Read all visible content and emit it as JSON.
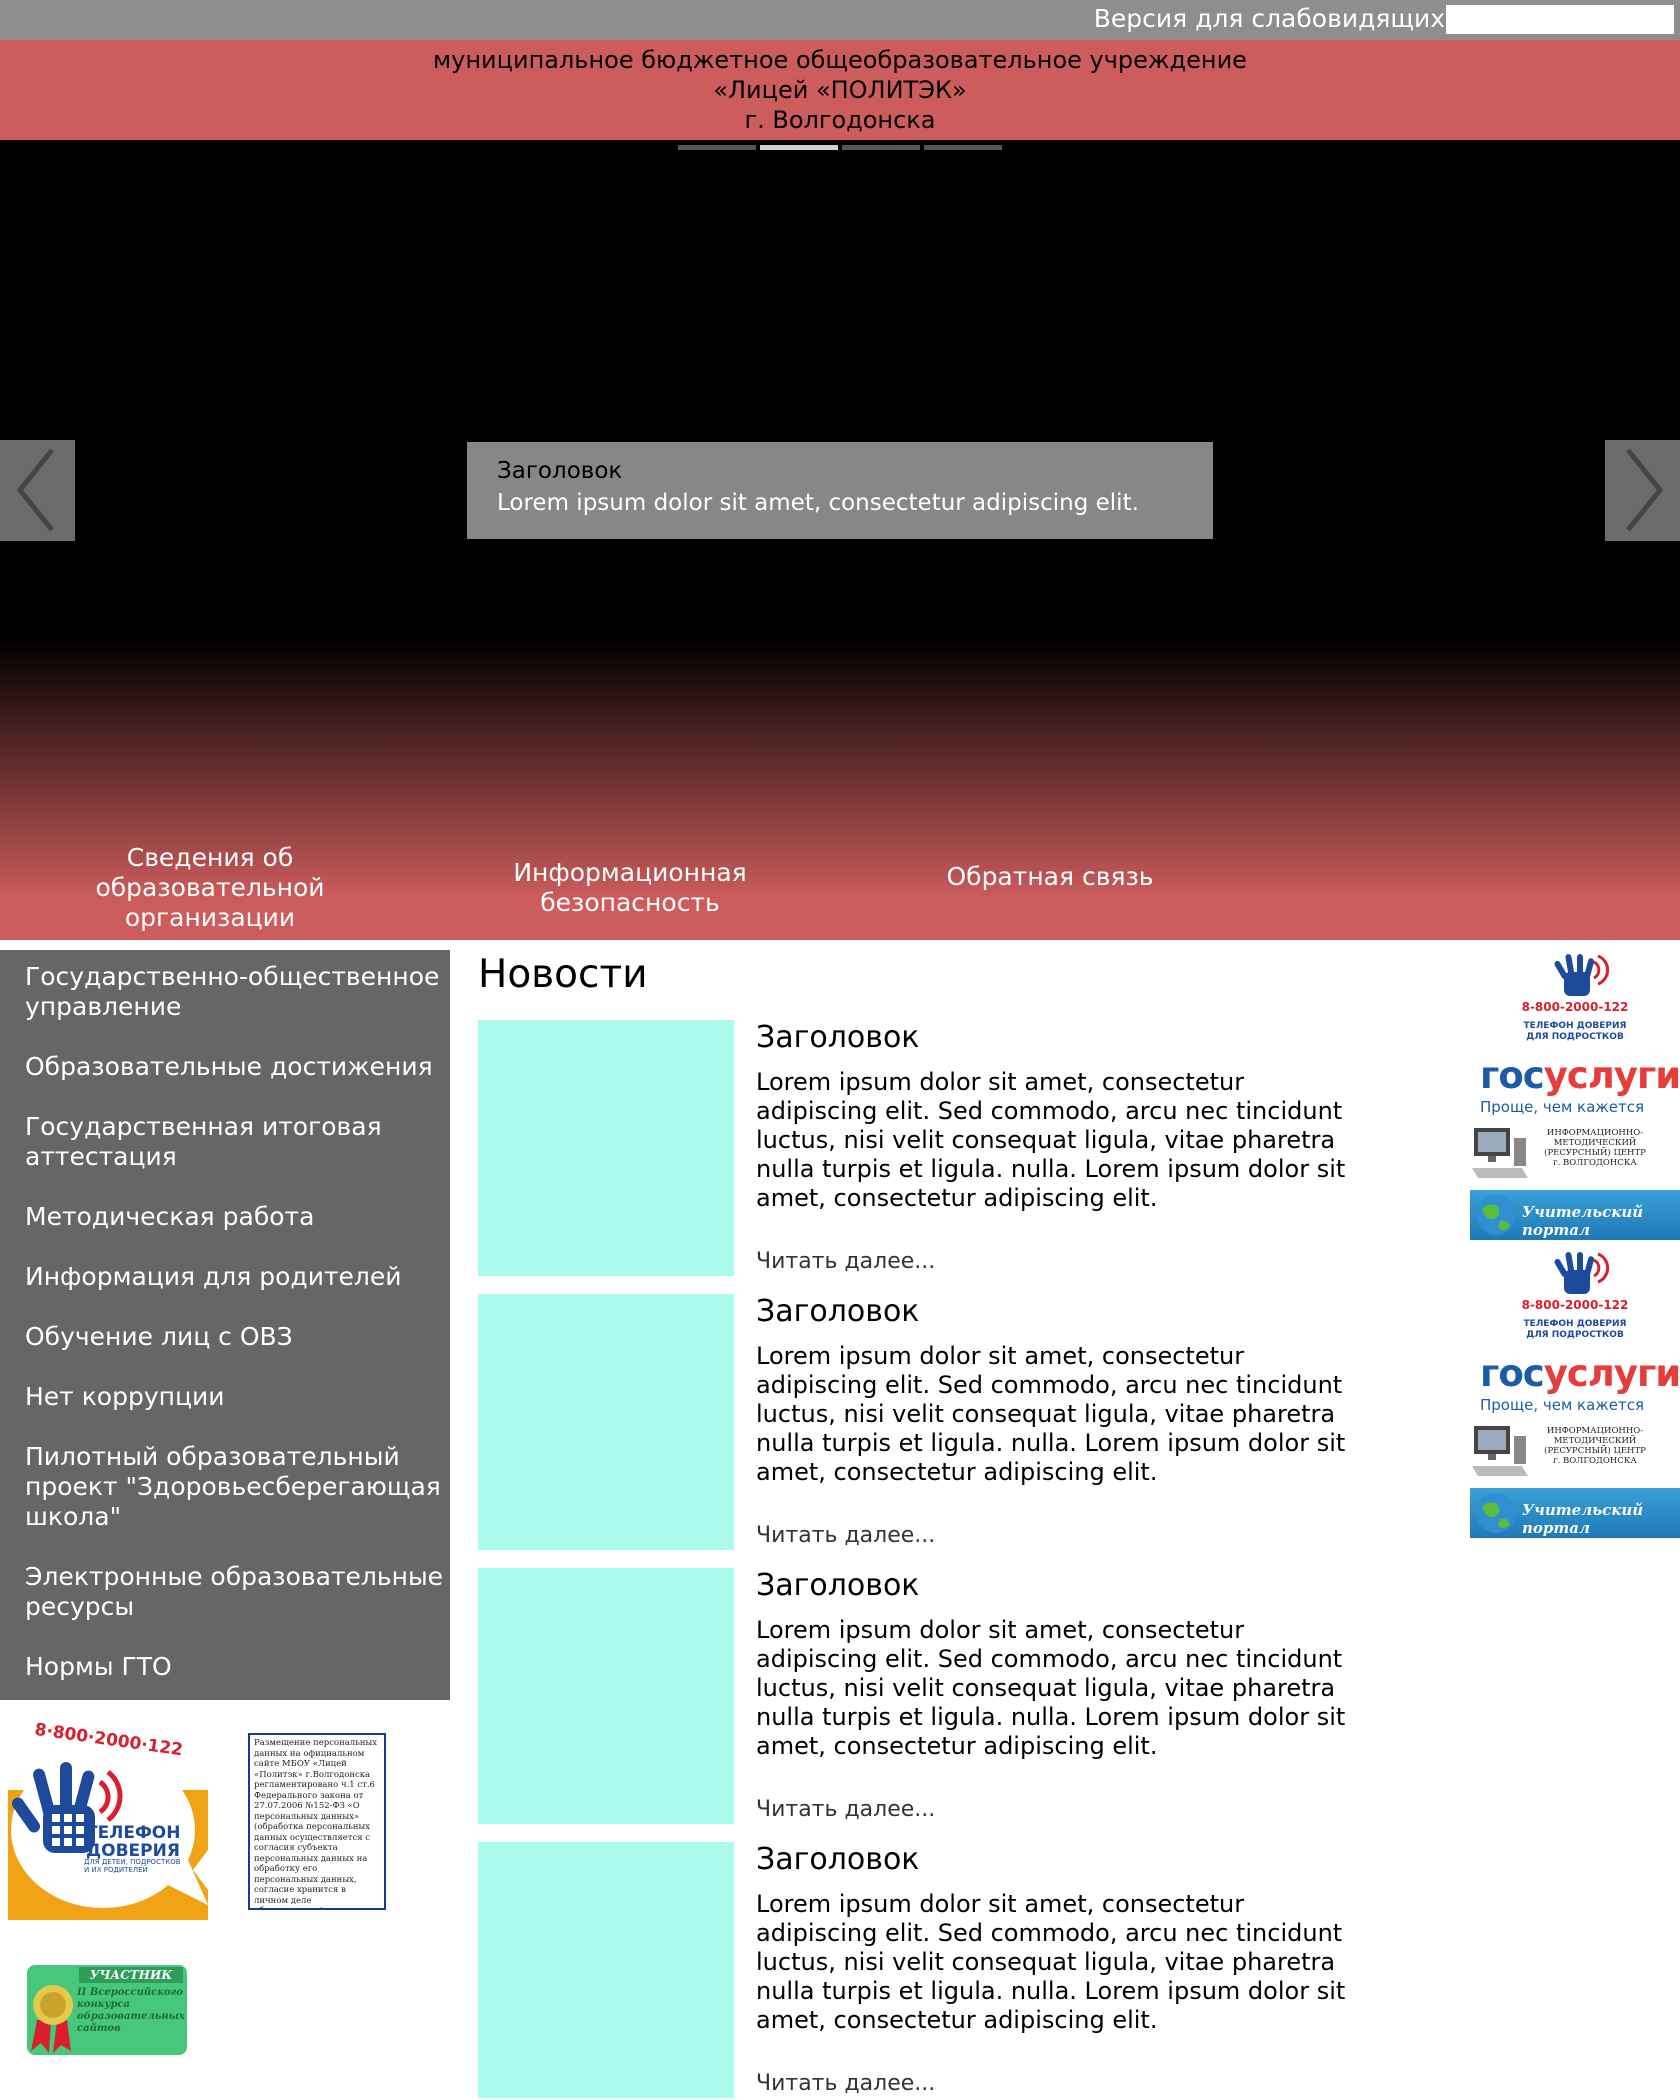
{
  "topbar": {
    "visually_impaired_label": "Версия для слабовидящих",
    "search_value": ""
  },
  "header": {
    "line1": "муниципальное бюджетное общеобразовательное учреждение",
    "line2": "«Лицей «ПОЛИТЭК»",
    "line3": "г. Волгодонска"
  },
  "slider": {
    "slide_count": 4,
    "active_index": 1,
    "caption_title": "Заголовок",
    "caption_text": "Lorem ipsum dolor sit amet, consectetur adipiscing elit."
  },
  "top_menu": [
    {
      "label": "Сведения об образовательной организации"
    },
    {
      "label": "Информационная безопасность"
    },
    {
      "label": "Обратная связь"
    }
  ],
  "sidebar": {
    "items": [
      {
        "label": "Государственно-общественное управление"
      },
      {
        "label": "Образовательные достижения"
      },
      {
        "label": "Государственная итоговая аттестация"
      },
      {
        "label": "Методическая работа"
      },
      {
        "label": "Информация для родителей"
      },
      {
        "label": "Обучение лиц с ОВЗ"
      },
      {
        "label": "Нет коррупции"
      },
      {
        "label": "Пилотный образовательный проект \"Здоровьесберегающая школа\""
      },
      {
        "label": "Электронные образовательные ресурсы"
      },
      {
        "label": "Нормы ГТО"
      }
    ]
  },
  "left_banners": {
    "trust_phone": "8·800·2000·122",
    "trust_title1": "ТЕЛЕФОН",
    "trust_title2": "ДОВЕРИЯ",
    "trust_sub": "ДЛЯ ДЕТЕЙ, ПОДРОСТКОВ И ИХ РОДИТЕЛЕЙ",
    "pd_text": "Размещение персональных данных на официальном сайте МБОУ «Лицей «Политэк» г.Волгодонска регламентировано ч.1 ст.6 Федерального закона от 27.07.2006 №152-ФЗ «О персональных данных» (обработка персональных данных осуществляется с согласия субъекта персональных данных на обработку его персональных данных, согласие хранится в личном деле обучающегося)",
    "participant_label": "УЧАСТНИК",
    "participant_text": "II Всероссийского конкурса образовательных сайтов"
  },
  "news": {
    "title": "Новости",
    "items": [
      {
        "title": "Заголовок",
        "text": "Lorem ipsum dolor sit amet, consectetur adipiscing elit. Sed commodo, arcu nec tincidunt luctus, nisi velit consequat ligula, vitae pharetra nulla turpis et ligula. nulla. Lorem ipsum dolor sit amet, consectetur adipiscing elit.",
        "more": "Читать далее..."
      },
      {
        "title": "Заголовок",
        "text": "Lorem ipsum dolor sit amet, consectetur adipiscing elit. Sed commodo, arcu nec tincidunt luctus, nisi velit consequat ligula, vitae pharetra nulla turpis et ligula. nulla. Lorem ipsum dolor sit amet, consectetur adipiscing elit.",
        "more": "Читать далее..."
      },
      {
        "title": "Заголовок",
        "text": "Lorem ipsum dolor sit amet, consectetur adipiscing elit. Sed commodo, arcu nec tincidunt luctus, nisi velit consequat ligula, vitae pharetra nulla turpis et ligula. nulla. Lorem ipsum dolor sit amet, consectetur adipiscing elit.",
        "more": "Читать далее..."
      },
      {
        "title": "Заголовок",
        "text": "Lorem ipsum dolor sit amet, consectetur adipiscing elit. Sed commodo, arcu nec tincidunt luctus, nisi velit consequat ligula, vitae pharetra nulla turpis et ligula. nulla. Lorem ipsum dolor sit amet, consectetur adipiscing elit.",
        "more": "Читать далее..."
      }
    ]
  },
  "right_banners": {
    "trust_phone": "8-800-2000-122",
    "trust_l1": "ТЕЛЕФОН ДОВЕРИЯ",
    "trust_l2": "ДЛЯ ПОДРОСТКОВ",
    "gos_part1": "гос",
    "gos_part2": "услуги",
    "gos_sub": "Проще, чем кажется",
    "imc_l1": "ИНФОРМАЦИОННО-МЕТОДИЧЕСКИЙ",
    "imc_l2": "(РЕСУРСНЫЙ) ЦЕНТР",
    "imc_l3": "г. ВОЛГОДОНСКА",
    "portal": "Учительский портал"
  },
  "colors": {
    "brand_red": "#cd5c5c",
    "sidebar_gray": "#666666",
    "thumb_mint": "#aafaee"
  }
}
